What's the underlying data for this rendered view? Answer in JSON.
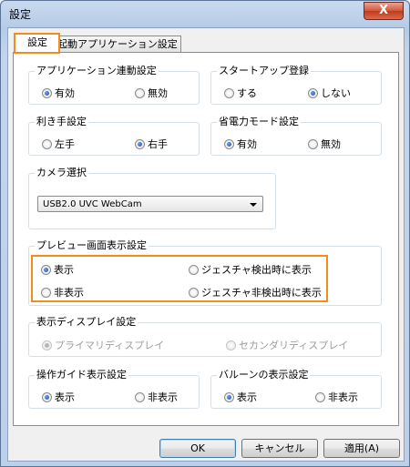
{
  "window": {
    "title": "設定",
    "close_label": "X"
  },
  "tabs": [
    {
      "label": "設定",
      "active": true
    },
    {
      "label": "起動アプリケーション設定",
      "active": false
    }
  ],
  "groups": {
    "app_link": {
      "title": "アプリケーション連動設定",
      "options": [
        "有効",
        "無効"
      ],
      "selected": 0
    },
    "startup": {
      "title": "スタートアップ登録",
      "options": [
        "する",
        "しない"
      ],
      "selected": 1
    },
    "handedness": {
      "title": "利き手設定",
      "options": [
        "左手",
        "右手"
      ],
      "selected": 1
    },
    "power_save": {
      "title": "省電力モード設定",
      "options": [
        "有効",
        "無効"
      ],
      "selected": 0
    },
    "camera": {
      "title": "カメラ選択",
      "value": "USB2.0 UVC WebCam"
    },
    "preview": {
      "title": "プレビュー画面表示設定",
      "options": [
        "表示",
        "ジェスチャ検出時に表示",
        "非表示",
        "ジェスチャ非検出時に表示"
      ],
      "selected": 0
    },
    "display": {
      "title": "表示ディスプレイ設定",
      "options": [
        "プライマリディスプレイ",
        "セカンダリディスプレイ"
      ],
      "selected": 0,
      "disabled": true
    },
    "guide": {
      "title": "操作ガイド表示設定",
      "options": [
        "表示",
        "非表示"
      ],
      "selected": 0
    },
    "balloon": {
      "title": "バルーンの表示設定",
      "options": [
        "表示",
        "非表示"
      ],
      "selected": 0
    }
  },
  "buttons": {
    "ok": "OK",
    "cancel": "キャンセル",
    "apply": "適用(A)"
  },
  "colors": {
    "highlight": "#f28c1d",
    "radio_selected": "#1c4da1"
  }
}
